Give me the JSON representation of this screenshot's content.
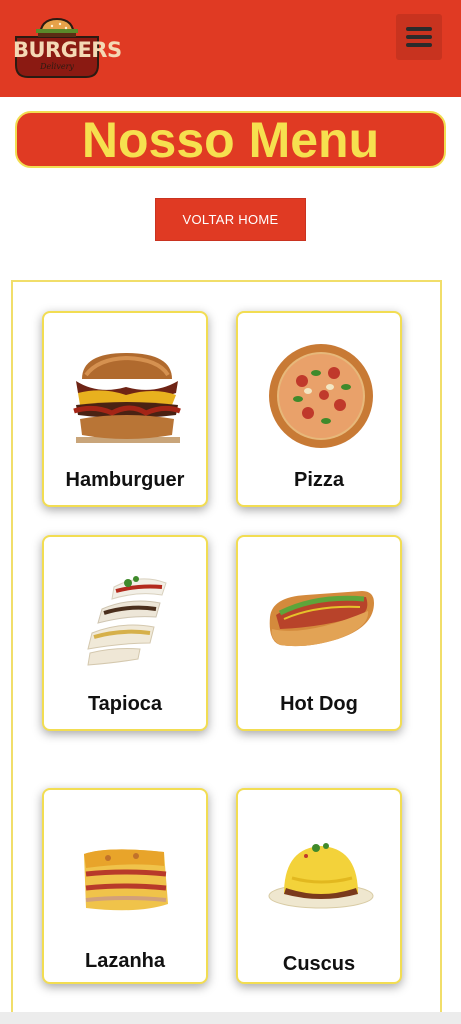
{
  "header": {
    "logo_text": "BURGERS",
    "logo_subtext": "Delivery",
    "menu_icon": "hamburger-menu-icon"
  },
  "page": {
    "title": "Nosso Menu",
    "home_button": "VOLTAR HOME"
  },
  "menu_items": [
    {
      "label": "Hamburguer",
      "icon": "hamburger-image"
    },
    {
      "label": "Pizza",
      "icon": "pizza-image"
    },
    {
      "label": "Tapioca",
      "icon": "tapioca-image"
    },
    {
      "label": "Hot Dog",
      "icon": "hot-dog-image"
    },
    {
      "label": "Lazanha",
      "icon": "lasagna-image"
    },
    {
      "label": "Cuscus",
      "icon": "cuscus-image"
    }
  ],
  "colors": {
    "brand_red": "#e03a23",
    "accent_yellow": "#f2dd52"
  }
}
